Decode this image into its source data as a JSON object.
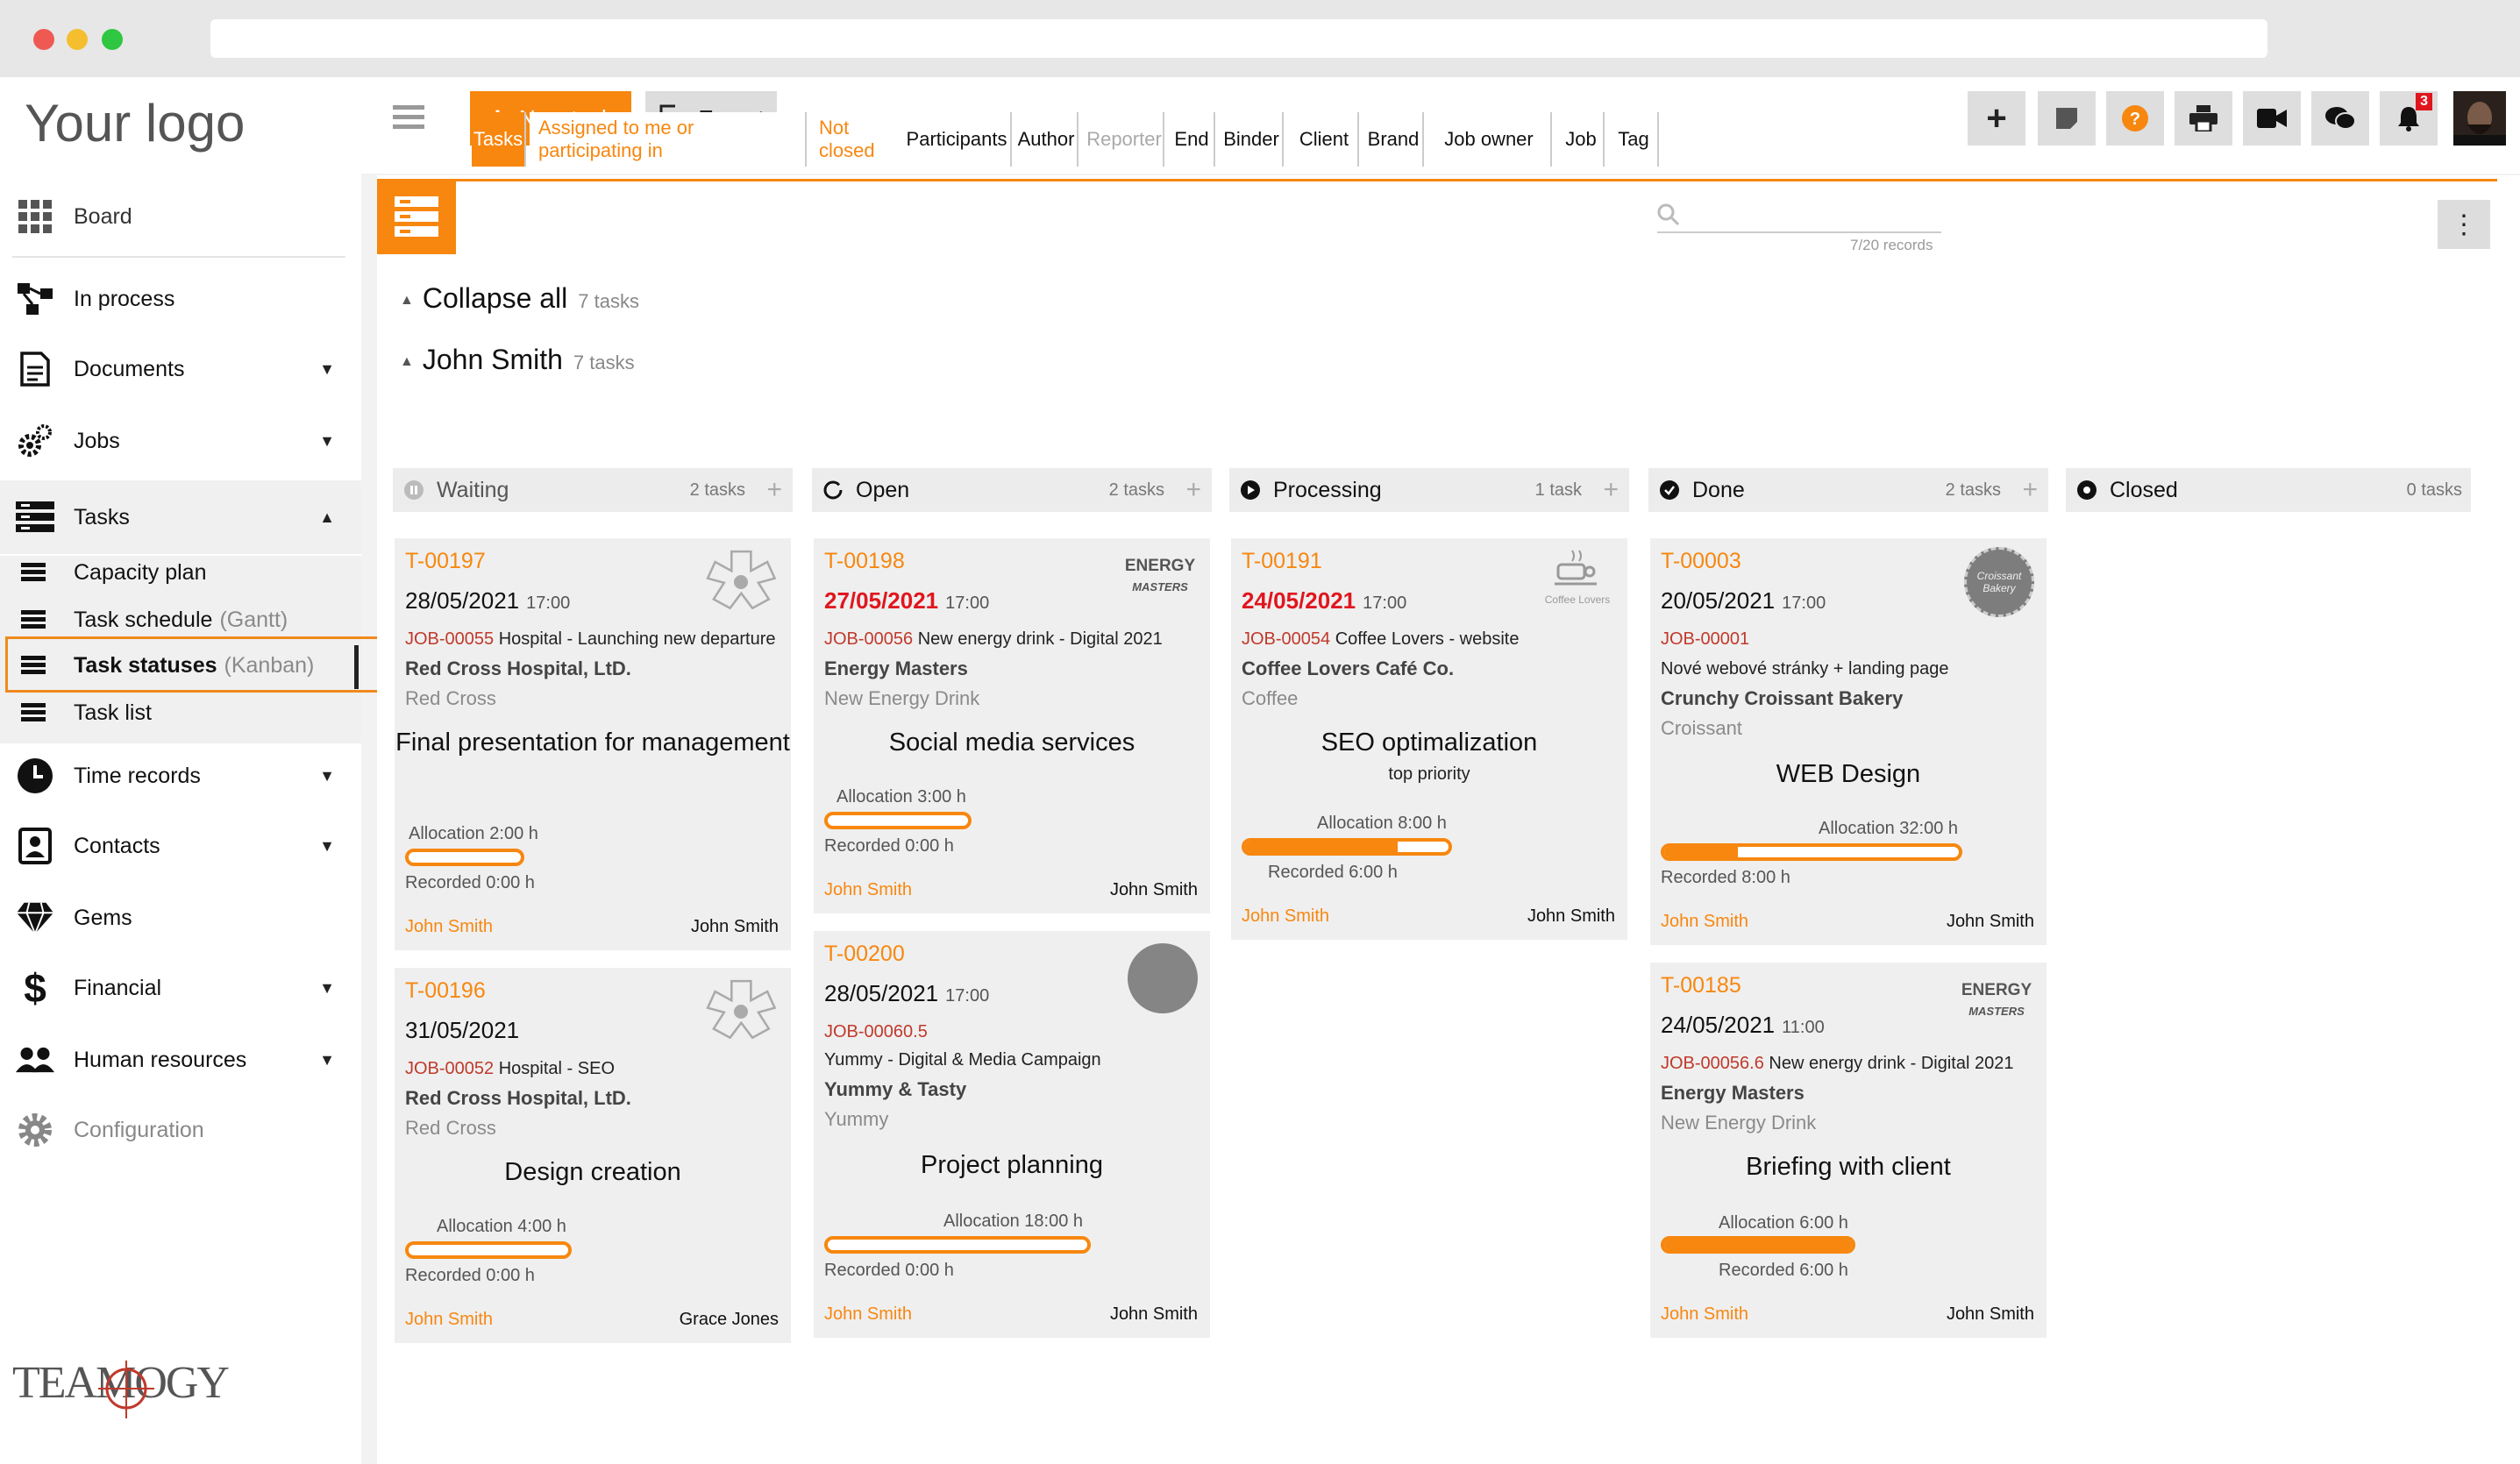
{
  "brand": {
    "logo_text": "Your logo",
    "footer_logo": "TEAMOGY",
    "accent": "#f7870f"
  },
  "sidebar": {
    "board": "Board",
    "in_process": "In process",
    "documents": "Documents",
    "jobs": "Jobs",
    "tasks": "Tasks",
    "capacity_plan": "Capacity plan",
    "task_schedule": "Task schedule",
    "task_schedule_suffix": "(Gantt)",
    "task_statuses": "Task statuses",
    "task_statuses_suffix": "(Kanban)",
    "task_list": "Task list",
    "time_records": "Time records",
    "contacts": "Contacts",
    "gems": "Gems",
    "financial": "Financial",
    "human_resources": "Human resources",
    "configuration": "Configuration"
  },
  "toolbar": {
    "new_task": "New task",
    "export": "Export",
    "notifications_count": "3"
  },
  "filters": {
    "crumbs": [
      "Tasks",
      "Assigned to me or participating in",
      "Not closed",
      "Participants",
      "Author",
      "Reporter",
      "End",
      "Binder",
      "Client",
      "Brand",
      "Job owner",
      "Job",
      "Tag"
    ],
    "records": "7/20 records"
  },
  "board": {
    "collapse_all": "Collapse all",
    "collapse_count": "7 tasks",
    "group_name": "John Smith",
    "group_count": "7 tasks"
  },
  "columns": [
    {
      "name": "Waiting",
      "count": "2 tasks"
    },
    {
      "name": "Open",
      "count": "2 tasks"
    },
    {
      "name": "Processing",
      "count": "1 task"
    },
    {
      "name": "Done",
      "count": "2 tasks"
    },
    {
      "name": "Closed",
      "count": "0 tasks"
    }
  ],
  "cards": {
    "c1": {
      "id": "T-00197",
      "date": "28/05/2021",
      "time": "17:00",
      "job": "JOB-00055",
      "job_text": "Hospital - Launching new departure",
      "client": "Red Cross Hospital, LtD.",
      "brand": "Red Cross",
      "title": "Final presentation for management",
      "alloc": "Allocation 2:00 h",
      "recorded": "Recorded 0:00 h",
      "progress": 0,
      "resp": "John Smith",
      "owner": "John Smith",
      "logo_caption": "Red Cross Hospital"
    },
    "c2": {
      "id": "T-00196",
      "date": "31/05/2021",
      "job": "JOB-00052",
      "job_text": "Hospital - SEO",
      "client": "Red Cross Hospital, LtD.",
      "brand": "Red Cross",
      "title": "Design creation",
      "alloc": "Allocation 4:00 h",
      "recorded": "Recorded 0:00 h",
      "progress": 0,
      "resp": "John Smith",
      "owner": "Grace Jones",
      "logo_caption": "Red Cross Hospital"
    },
    "c3": {
      "id": "T-00198",
      "date": "27/05/2021",
      "time": "17:00",
      "job": "JOB-00056",
      "job_text": "New energy drink - Digital 2021",
      "client": "Energy Masters",
      "brand": "New Energy Drink",
      "title": "Social media services",
      "alloc": "Allocation 3:00 h",
      "recorded": "Recorded 0:00 h",
      "progress": 0,
      "resp": "John Smith",
      "owner": "John Smith",
      "logo_top": "ENERGY",
      "logo_bottom": "MASTERS"
    },
    "c4": {
      "id": "T-00200",
      "date": "28/05/2021",
      "time": "17:00",
      "job": "JOB-00060.5",
      "job_text": "Yummy - Digital & Media Campaign",
      "client": "Yummy & Tasty",
      "brand": "Yummy",
      "title": "Project planning",
      "alloc": "Allocation 18:00 h",
      "recorded": "Recorded 0:00 h",
      "progress": 0,
      "resp": "John Smith",
      "owner": "John Smith"
    },
    "c5": {
      "id": "T-00191",
      "date": "24/05/2021",
      "time": "17:00",
      "job": "JOB-00054",
      "job_text": "Coffee Lovers - website",
      "client": "Coffee Lovers Café Co.",
      "brand": "Coffee",
      "title": "SEO optimalization",
      "subtitle": "top priority",
      "alloc": "Allocation 8:00 h",
      "recorded": "Recorded 6:00 h",
      "progress": 0.75,
      "resp": "John Smith",
      "owner": "John Smith",
      "logo_caption": "Coffee Lovers"
    },
    "c6": {
      "id": "T-00003",
      "date": "20/05/2021",
      "time": "17:00",
      "job": "JOB-00001",
      "job_text": "Nové webové stránky + landing page",
      "client": "Crunchy Croissant Bakery",
      "brand": "Croissant",
      "title": "WEB Design",
      "alloc": "Allocation 32:00 h",
      "recorded": "Recorded 8:00 h",
      "progress": 0.25,
      "resp": "John Smith",
      "owner": "John Smith",
      "logo_text": "Croissant Bakery"
    },
    "c7": {
      "id": "T-00185",
      "date": "24/05/2021",
      "time": "11:00",
      "job": "JOB-00056.6",
      "job_text": "New energy drink - Digital 2021",
      "client": "Energy Masters",
      "brand": "New Energy Drink",
      "title": "Briefing with client",
      "alloc": "Allocation 6:00 h",
      "recorded": "Recorded 6:00 h",
      "progress": 1,
      "resp": "John Smith",
      "owner": "John Smith",
      "logo_top": "ENERGY",
      "logo_bottom": "MASTERS"
    }
  }
}
